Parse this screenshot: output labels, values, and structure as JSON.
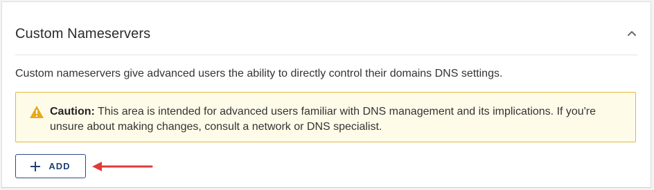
{
  "section": {
    "title": "Custom Nameservers",
    "collapse_icon": "chevron-up-icon",
    "description": "Custom nameservers give advanced users the ability to directly control their domains DNS settings."
  },
  "caution": {
    "icon": "warning-triangle-icon",
    "label": "Caution:",
    "message": " This area is intended for advanced users familiar with DNS management and its implications. If you're unsure about making changes, consult a network or DNS specialist.",
    "border_color": "#e2b93b",
    "background_color": "#fffbe9",
    "icon_color": "#e8a91a"
  },
  "actions": {
    "add_label": "ADD",
    "add_icon": "plus-icon",
    "accent_color": "#1f3f77"
  },
  "annotation": {
    "type": "red-arrow-pointing-left",
    "color": "#e03a3a"
  }
}
